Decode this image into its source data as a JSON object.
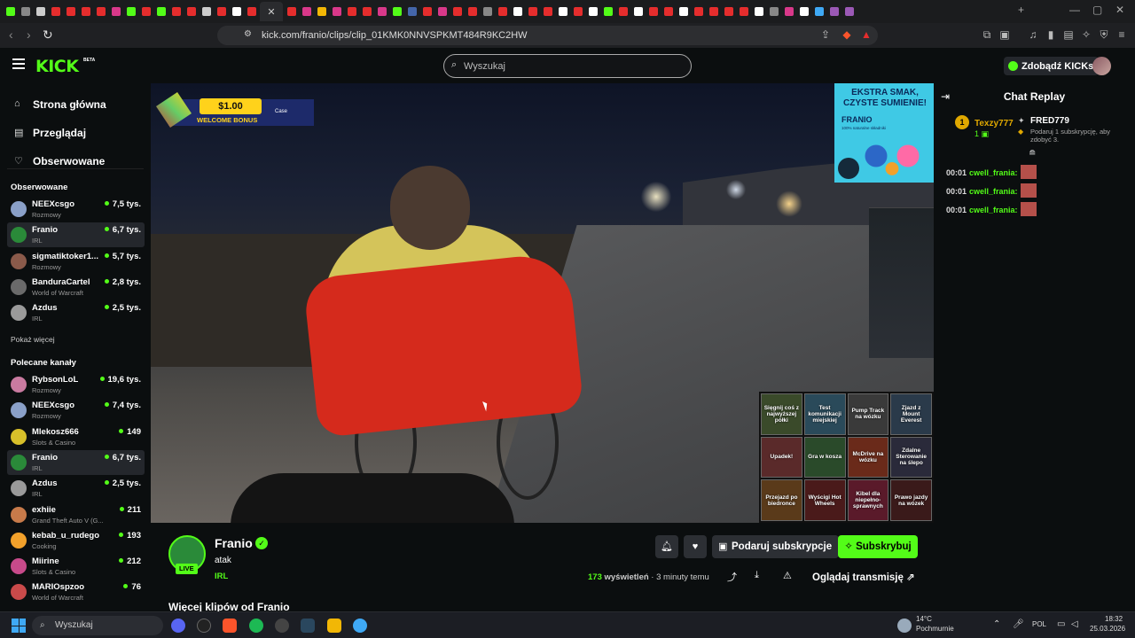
{
  "browser": {
    "url": "kick.com/franio/clips/clip_01KMK0NNVSPKMT484R9KC2HW",
    "tab_colors": [
      "#53fc18",
      "#888",
      "#ccc",
      "#e52d2d",
      "#e52d2d",
      "#e52d2d",
      "#e52d2d",
      "#d9388a",
      "#53fc18",
      "#e52d2d",
      "#53fc18",
      "#e52d2d",
      "#e52d2d",
      "#cccccc",
      "#e52d2d",
      "#ffffff",
      "#e52d2d",
      "#ffffff",
      "#e52d2d",
      "#d9388a",
      "#f2b705",
      "#d9388a",
      "#e52d2d",
      "#e52d2d",
      "#d9388a",
      "#53fc18",
      "#46a",
      "#e52d2d",
      "#d9388a",
      "#e52d2d",
      "#e52d2d",
      "#888",
      "#e52d2d",
      "#fff",
      "#e52d2d",
      "#e52d2d",
      "#fff",
      "#e52d2d",
      "#fff",
      "#53fc18",
      "#e52d2d",
      "#fff",
      "#e52d2d",
      "#e52d2d",
      "#fff",
      "#e52d2d",
      "#e52d2d",
      "#e52d2d",
      "#e52d2d",
      "#fff",
      "#888",
      "#d9388a",
      "#fff",
      "#3fa9f5",
      "#9b59b6",
      "#9b59b6"
    ]
  },
  "header": {
    "logo": "KICK",
    "beta": "BETA",
    "search_placeholder": "Wyszukaj",
    "get_kicks": "Zdobądź KICKs"
  },
  "sidebar": {
    "nav": [
      {
        "label": "Strona główna",
        "icon": "home-icon"
      },
      {
        "label": "Przeglądaj",
        "icon": "browse-icon"
      },
      {
        "label": "Obserwowane",
        "icon": "heart-icon"
      }
    ],
    "following_title": "Obserwowane",
    "following": [
      {
        "name": "NEEXcsgo",
        "category": "Rozmowy",
        "viewers": "7,5 tys.",
        "color": "#8aa0c8"
      },
      {
        "name": "Franio",
        "category": "IRL",
        "viewers": "6,7 tys.",
        "color": "#2a8a39"
      },
      {
        "name": "sigmatiktoker1...",
        "category": "Rozmowy",
        "viewers": "5,7 tys.",
        "color": "#8a5a4a"
      },
      {
        "name": "BanduraCartel",
        "category": "World of Warcraft",
        "viewers": "2,8 tys.",
        "color": "#6a6a6a"
      },
      {
        "name": "Azdus",
        "category": "IRL",
        "viewers": "2,5 tys.",
        "color": "#9a9a9a"
      }
    ],
    "show_more": "Pokaż więcej",
    "recommended_title": "Polecane kanały",
    "recommended": [
      {
        "name": "RybsonLoL",
        "category": "Rozmowy",
        "viewers": "19,6 tys.",
        "color": "#c97aa0"
      },
      {
        "name": "NEEXcsgo",
        "category": "Rozmowy",
        "viewers": "7,4 tys.",
        "color": "#8aa0c8"
      },
      {
        "name": "Mlekosz666",
        "category": "Slots & Casino",
        "viewers": "149",
        "color": "#d8c02a"
      },
      {
        "name": "Franio",
        "category": "IRL",
        "viewers": "6,7 tys.",
        "color": "#2a8a39"
      },
      {
        "name": "Azdus",
        "category": "IRL",
        "viewers": "2,5 tys.",
        "color": "#9a9a9a"
      },
      {
        "name": "exhiie",
        "category": "Grand Theft Auto V (G...",
        "viewers": "211",
        "color": "#c77a4a"
      },
      {
        "name": "kebab_u_rudego",
        "category": "Cooking",
        "viewers": "193",
        "color": "#f2a12b"
      },
      {
        "name": "Miirine",
        "category": "Slots & Casino",
        "viewers": "212",
        "color": "#c74a8a"
      },
      {
        "name": "MARIOspzoo",
        "category": "World of Warcraft",
        "viewers": "76",
        "color": "#c94a4a"
      }
    ]
  },
  "video": {
    "ad_top_amount": "$1.00",
    "ad_top_text": "WELCOME BONUS",
    "ad_top_brand": "Case",
    "ad_right_headline": "EKSTRA SMAK, CZYSTE SUMIENIE!",
    "ad_right_brand": "FRANIO",
    "ad_right_sub": "100% naturalne składniki",
    "grid": [
      "Sięgnij coś z najwyższej półki",
      "Test komunikacji miejskiej",
      "Pump Track na wózku",
      "Zjazd z Mount Everest",
      "Upadek!",
      "Gra w kosza",
      "McDrive na wózku",
      "Zdalne Sterowanie na ślepo",
      "Przejazd po biedronce",
      "Wyścigi Hot Wheels",
      "Kibel dla niepełno-sprawnych",
      "Prawo jazdy na wózek"
    ]
  },
  "chat": {
    "title": "Chat Replay",
    "gifter1": {
      "badge": "1",
      "name": "Texzy777",
      "count": "1"
    },
    "gifter2": {
      "name": "FRED779",
      "count": "1",
      "note": "Podaruj 1 subskrypcję, aby zdobyć 3."
    },
    "messages": [
      {
        "time": "00:01",
        "user": "cwell_frania:"
      },
      {
        "time": "00:01",
        "user": "cwell_frania:"
      },
      {
        "time": "00:01",
        "user": "cwell_frania:"
      }
    ]
  },
  "info": {
    "channel": "Franio",
    "live": "LIVE",
    "title": "atak",
    "category": "IRL",
    "gift_label": "Podaruj subskrypcje",
    "subscribe_label": "Subskrybuj",
    "views_count": "173",
    "views_label": "wyświetleń",
    "time_ago": "3 minuty temu",
    "watch_label": "Oglądaj transmisję",
    "more_clips": "Więcej klipów od Franio"
  },
  "taskbar": {
    "search": "Wyszukaj",
    "weather_temp": "14°C",
    "weather_desc": "Pochmurnie",
    "lang": "POL",
    "time": "18:32",
    "date": "25.03.2026"
  }
}
